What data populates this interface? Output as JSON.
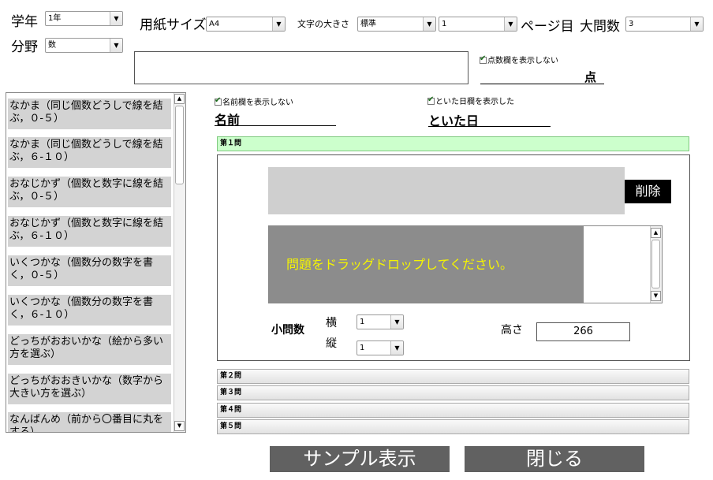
{
  "settings": {
    "grade_label": "学年",
    "grade_value": "1年",
    "paper_label": "用紙サイズ",
    "paper_value": "A4",
    "font_size_label": "文字の大きさ",
    "font_size_value": "標準",
    "page_value": "1",
    "page_label": "ページ目",
    "big_questions_label": "大問数",
    "big_questions_value": "3",
    "field_label": "分野",
    "field_value": "数"
  },
  "score": {
    "hide_label": "点数欄を表示しない",
    "unit": "点"
  },
  "sidebar": {
    "items": [
      {
        "label": "なかま（同じ個数どうしで線を結ぶ，０‐５）"
      },
      {
        "label": "なかま（同じ個数どうしで線を結ぶ，６‐１０）"
      },
      {
        "label": "おなじかず（個数と数字に線を結ぶ，０‐５）"
      },
      {
        "label": "おなじかず（個数と数字に線を結ぶ，６‐１０）"
      },
      {
        "label": "いくつかな（個数分の数字を書く，０‐５）"
      },
      {
        "label": "いくつかな（個数分の数字を書く，６‐１０）"
      },
      {
        "label": "どっちがおおいかな（絵から多い方を選ぶ）"
      },
      {
        "label": "どっちがおおきいかな（数字から大きい方を選ぶ）"
      },
      {
        "label": "なんばんめ（前から〇番目に丸をする）"
      }
    ]
  },
  "header": {
    "name_hide_label": "名前欄を表示しない",
    "name_label": "名前",
    "date_hide_label": "といた日欄を表示した",
    "date_label": "といた日"
  },
  "questions": {
    "q1_title": "第１問",
    "delete_label": "削除",
    "drop_hint": "問題をドラッグドロップしてください。",
    "sub_label": "小問数",
    "horizontal_label": "横",
    "vertical_label": "縦",
    "horizontal_value": "1",
    "vertical_value": "1",
    "height_label": "高さ",
    "height_value": "266",
    "q2_title": "第２問",
    "q3_title": "第３問",
    "q4_title": "第４問",
    "q5_title": "第５問"
  },
  "footer": {
    "sample_label": "サンプル表示",
    "close_label": "閉じる"
  },
  "colors": {
    "accent_green": "#ccffcc",
    "button_gray": "#616161",
    "drop_area": "#8c8c8c",
    "drop_text": "#f5f500"
  }
}
